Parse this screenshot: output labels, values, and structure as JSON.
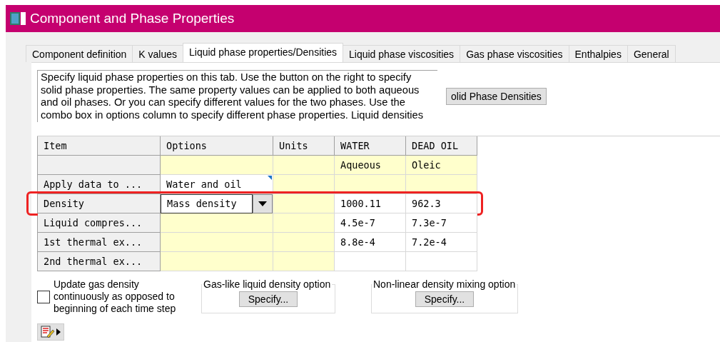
{
  "window": {
    "title": "Component and Phase Properties"
  },
  "tabs": [
    {
      "label": "Component definition",
      "selected": false
    },
    {
      "label": "K values",
      "selected": false
    },
    {
      "label": "Liquid phase properties/Densities",
      "selected": true
    },
    {
      "label": "Liquid phase viscosities",
      "selected": false
    },
    {
      "label": "Gas phase viscosities",
      "selected": false
    },
    {
      "label": "Enthalpies",
      "selected": false
    },
    {
      "label": "General",
      "selected": false
    }
  ],
  "description": "Specify liquid phase properties on this tab. Use the button on the right to specify solid phase properties. The same property values can be applied to both aqueous and oil phases. Or you can specify different values for the two phases. Use the combo box in options column to specify different phase properties. Liquid densities",
  "solid_button": "olid Phase Densities",
  "table": {
    "columns": [
      "Item",
      "Options",
      "Units",
      "WATER",
      "DEAD OIL"
    ],
    "rows": [
      {
        "highlighted": false,
        "cells": [
          {
            "kind": "header"
          },
          {
            "kind": "editable"
          },
          {
            "kind": "editable"
          },
          {
            "kind": "editable",
            "text": "Aqueous"
          },
          {
            "kind": "editable",
            "text": "Oleic"
          }
        ]
      },
      {
        "highlighted": false,
        "cells": [
          {
            "kind": "header",
            "text": "Apply data to ..."
          },
          {
            "kind": "menu",
            "text": "Water and oil"
          },
          {
            "kind": "editable"
          },
          {
            "kind": "editable"
          },
          {
            "kind": "editable"
          }
        ]
      },
      {
        "highlighted": true,
        "cells": [
          {
            "kind": "header",
            "text": "Density"
          },
          {
            "kind": "combo",
            "text": "Mass density"
          },
          {
            "kind": "editable"
          },
          {
            "kind": "value",
            "text": "1000.11"
          },
          {
            "kind": "value",
            "text": "962.3"
          }
        ]
      },
      {
        "highlighted": false,
        "cells": [
          {
            "kind": "header",
            "text": "Liquid compres..."
          },
          {
            "kind": "editable"
          },
          {
            "kind": "editable"
          },
          {
            "kind": "value",
            "text": "4.5e-7"
          },
          {
            "kind": "value",
            "text": "7.3e-7"
          }
        ]
      },
      {
        "highlighted": false,
        "cells": [
          {
            "kind": "header",
            "text": "1st thermal ex..."
          },
          {
            "kind": "editable"
          },
          {
            "kind": "editable"
          },
          {
            "kind": "value",
            "text": "8.8e-4"
          },
          {
            "kind": "value",
            "text": "7.2e-4"
          }
        ]
      },
      {
        "highlighted": false,
        "cells": [
          {
            "kind": "header",
            "text": "2nd thermal ex..."
          },
          {
            "kind": "editable"
          },
          {
            "kind": "editable"
          },
          {
            "kind": "value"
          },
          {
            "kind": "value"
          }
        ]
      }
    ]
  },
  "update_checkbox": {
    "label": "Update gas density continuously as opposed to beginning of each time step",
    "checked": false
  },
  "groups": [
    {
      "title": "Gas-like liquid density option",
      "button": "Specify..."
    },
    {
      "title": "Non-linear density mixing option",
      "button": "Specify..."
    }
  ]
}
